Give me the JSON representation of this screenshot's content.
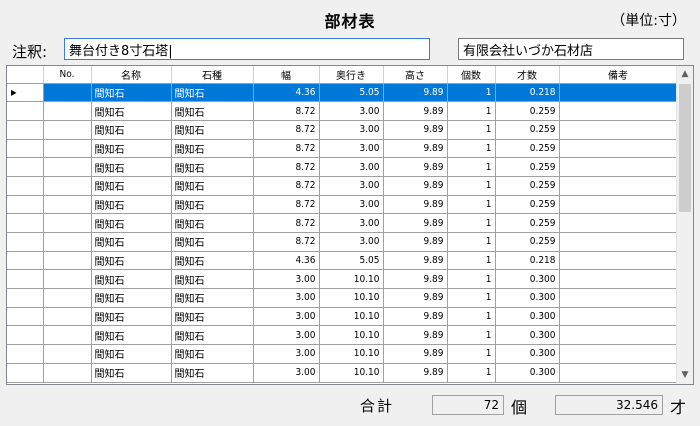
{
  "header": {
    "title": "部材表",
    "unit": "（単位:寸）",
    "note_label": "注釈:",
    "note_value": "舞台付き8寸石塔|",
    "shop_value": "有限会社いづか石材店"
  },
  "table": {
    "columns": [
      "No.",
      "名称",
      "石種",
      "幅",
      "奥行き",
      "高さ",
      "個数",
      "才数",
      "備考"
    ],
    "rows": [
      {
        "no": "",
        "name": "間知石",
        "stone": "間知石",
        "width": "4.36",
        "depth": "5.05",
        "height": "9.89",
        "count": "1",
        "volume": "0.218",
        "note": ""
      },
      {
        "no": "",
        "name": "間知石",
        "stone": "間知石",
        "width": "8.72",
        "depth": "3.00",
        "height": "9.89",
        "count": "1",
        "volume": "0.259",
        "note": ""
      },
      {
        "no": "",
        "name": "間知石",
        "stone": "間知石",
        "width": "8.72",
        "depth": "3.00",
        "height": "9.89",
        "count": "1",
        "volume": "0.259",
        "note": ""
      },
      {
        "no": "",
        "name": "間知石",
        "stone": "間知石",
        "width": "8.72",
        "depth": "3.00",
        "height": "9.89",
        "count": "1",
        "volume": "0.259",
        "note": ""
      },
      {
        "no": "",
        "name": "間知石",
        "stone": "間知石",
        "width": "8.72",
        "depth": "3.00",
        "height": "9.89",
        "count": "1",
        "volume": "0.259",
        "note": ""
      },
      {
        "no": "",
        "name": "間知石",
        "stone": "間知石",
        "width": "8.72",
        "depth": "3.00",
        "height": "9.89",
        "count": "1",
        "volume": "0.259",
        "note": ""
      },
      {
        "no": "",
        "name": "間知石",
        "stone": "間知石",
        "width": "8.72",
        "depth": "3.00",
        "height": "9.89",
        "count": "1",
        "volume": "0.259",
        "note": ""
      },
      {
        "no": "",
        "name": "間知石",
        "stone": "間知石",
        "width": "8.72",
        "depth": "3.00",
        "height": "9.89",
        "count": "1",
        "volume": "0.259",
        "note": ""
      },
      {
        "no": "",
        "name": "間知石",
        "stone": "間知石",
        "width": "8.72",
        "depth": "3.00",
        "height": "9.89",
        "count": "1",
        "volume": "0.259",
        "note": ""
      },
      {
        "no": "",
        "name": "間知石",
        "stone": "間知石",
        "width": "4.36",
        "depth": "5.05",
        "height": "9.89",
        "count": "1",
        "volume": "0.218",
        "note": ""
      },
      {
        "no": "",
        "name": "間知石",
        "stone": "間知石",
        "width": "3.00",
        "depth": "10.10",
        "height": "9.89",
        "count": "1",
        "volume": "0.300",
        "note": ""
      },
      {
        "no": "",
        "name": "間知石",
        "stone": "間知石",
        "width": "3.00",
        "depth": "10.10",
        "height": "9.89",
        "count": "1",
        "volume": "0.300",
        "note": ""
      },
      {
        "no": "",
        "name": "間知石",
        "stone": "間知石",
        "width": "3.00",
        "depth": "10.10",
        "height": "9.89",
        "count": "1",
        "volume": "0.300",
        "note": ""
      },
      {
        "no": "",
        "name": "間知石",
        "stone": "間知石",
        "width": "3.00",
        "depth": "10.10",
        "height": "9.89",
        "count": "1",
        "volume": "0.300",
        "note": ""
      },
      {
        "no": "",
        "name": "間知石",
        "stone": "間知石",
        "width": "3.00",
        "depth": "10.10",
        "height": "9.89",
        "count": "1",
        "volume": "0.300",
        "note": ""
      },
      {
        "no": "",
        "name": "間知石",
        "stone": "間知石",
        "width": "3.00",
        "depth": "10.10",
        "height": "9.89",
        "count": "1",
        "volume": "0.300",
        "note": ""
      }
    ],
    "selected_row_marker": "▶"
  },
  "footer": {
    "total_label": "合計",
    "total_count": "72",
    "count_unit": "個",
    "total_volume": "32.546",
    "volume_unit": "才"
  },
  "colors": {
    "selection": "#0078d7",
    "window_bg": "#f0f0f0"
  },
  "icons": {
    "scroll_up": "▲",
    "scroll_down": "▼"
  }
}
